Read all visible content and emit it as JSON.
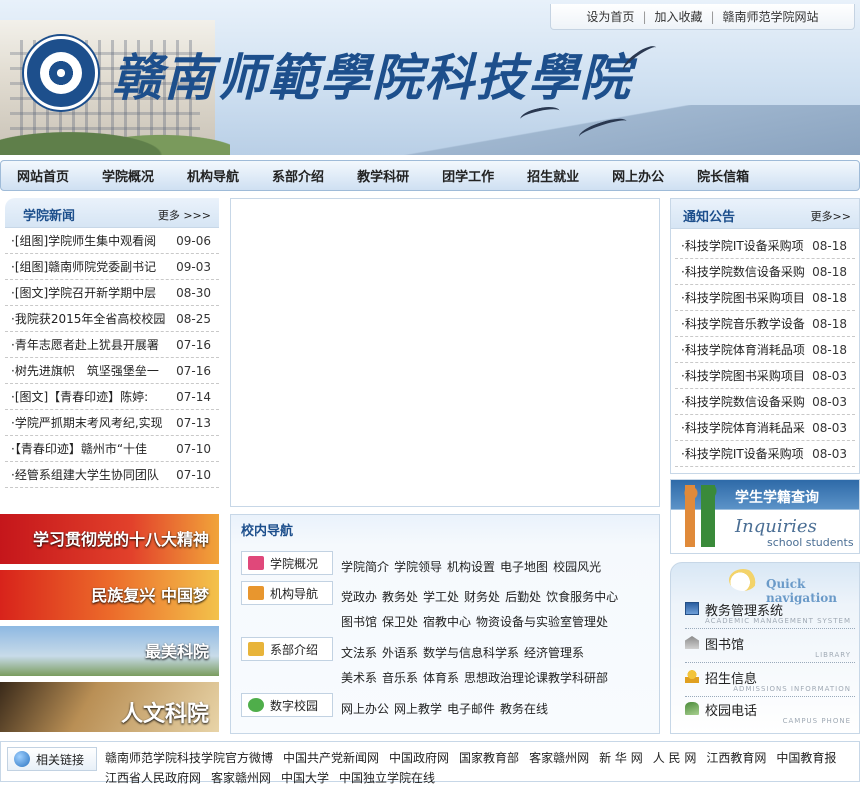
{
  "banner": {
    "site_title": "赣南师範學院科技學院",
    "top_links": [
      "设为首页",
      "加入收藏",
      "赣南师范学院网站"
    ]
  },
  "nav": [
    "网站首页",
    "学院概况",
    "机构导航",
    "系部介绍",
    "教学科研",
    "团学工作",
    "招生就业",
    "网上办公",
    "院长信箱"
  ],
  "news": {
    "title": "学院新闻",
    "more": "更多 >>>",
    "items": [
      {
        "text": "·[组图]学院师生集中观看阅",
        "date": "09-06"
      },
      {
        "text": "·[组图]赣南师院党委副书记",
        "date": "09-03"
      },
      {
        "text": "·[图文]学院召开新学期中层",
        "date": "08-30"
      },
      {
        "text": "·我院获2015年全省高校校园",
        "date": "08-25"
      },
      {
        "text": "·青年志愿者赴上犹县开展署",
        "date": "07-16"
      },
      {
        "text": "·树先进旗帜　筑坚强堡垒一",
        "date": "07-16"
      },
      {
        "text": "·[图文]【青春印迹】陈婷:",
        "date": "07-14"
      },
      {
        "text": "·学院严抓期末考风考纪,实现",
        "date": "07-13"
      },
      {
        "text": "·【青春印迹】赣州市“十佳",
        "date": "07-10"
      },
      {
        "text": "·经管系组建大学生协同团队",
        "date": "07-10"
      }
    ]
  },
  "promos": [
    "学习贯彻党的十八大精神",
    "民族复兴 中国梦",
    "最美科院",
    "人文科院"
  ],
  "campus_nav": {
    "title": "校内导航",
    "rows": [
      {
        "label": "学院概况",
        "links": [
          "学院简介",
          "学院领导",
          "机构设置",
          "电子地图",
          "校园风光"
        ]
      },
      {
        "label": "机构导航",
        "links": [
          "党政办",
          "教务处",
          "学工处",
          "财务处",
          "后勤处",
          "饮食服务中心",
          "图书馆",
          "保卫处",
          "宿教中心",
          "物资设备与实验室管理处"
        ]
      },
      {
        "label": "系部介绍",
        "links": [
          "文法系",
          "外语系",
          "数学与信息科学系",
          "经济管理系",
          "美术系",
          "音乐系",
          "体育系",
          "思想政治理论课教学科研部"
        ]
      },
      {
        "label": "数字校园",
        "links": [
          "网上办公",
          "网上教学",
          "电子邮件",
          "教务在线"
        ]
      }
    ]
  },
  "notice": {
    "title": "通知公告",
    "more": "更多>>",
    "items": [
      {
        "text": "·科技学院IT设备采购项",
        "date": "08-18"
      },
      {
        "text": "·科技学院数信设备采购",
        "date": "08-18"
      },
      {
        "text": "·科技学院图书采购项目",
        "date": "08-18"
      },
      {
        "text": "·科技学院音乐教学设备",
        "date": "08-18"
      },
      {
        "text": "·科技学院体育消耗品项",
        "date": "08-18"
      },
      {
        "text": "·科技学院图书采购项目",
        "date": "08-03"
      },
      {
        "text": "·科技学院数信设备采购",
        "date": "08-03"
      },
      {
        "text": "·科技学院体育消耗品采",
        "date": "08-03"
      },
      {
        "text": "·科技学院IT设备采购项",
        "date": "08-03"
      }
    ]
  },
  "inquiries": {
    "cn": "学生学籍查询",
    "en1": "Inquiries",
    "en2": "school students"
  },
  "quick": {
    "title": "Quick navigation",
    "items": [
      {
        "cn": "教务管理系统",
        "en": "ACADEMIC MANAGEMENT SYSTEM"
      },
      {
        "cn": "图书馆",
        "en": "LIBRARY"
      },
      {
        "cn": "招生信息",
        "en": "ADMISSIONS INFORMATION"
      },
      {
        "cn": "校园电话",
        "en": "CAMPUS PHONE"
      }
    ]
  },
  "footer": {
    "label": "相关链接",
    "links": [
      "赣南师范学院科技学院官方微博",
      "中国共产党新闻网",
      "中国政府网",
      "国家教育部",
      "客家赣州网",
      "新 华 网",
      "人 民 网",
      "江西教育网",
      "中国教育报",
      "江西省人民政府网",
      "客家赣州网",
      "中国大学",
      "中国独立学院在线"
    ]
  }
}
